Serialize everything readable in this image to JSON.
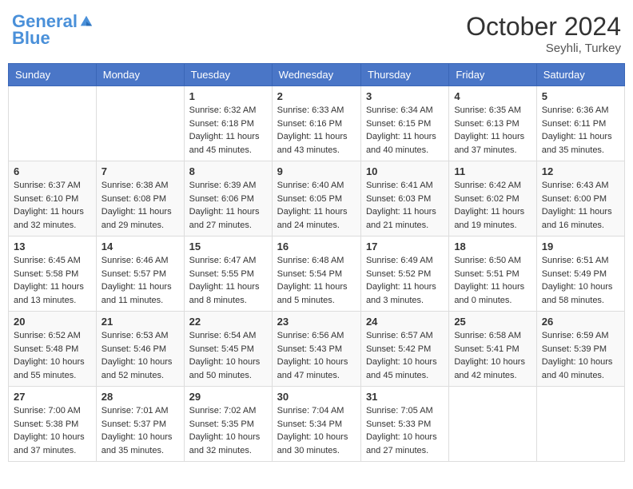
{
  "header": {
    "logo_line1": "General",
    "logo_line2": "Blue",
    "month_year": "October 2024",
    "location": "Seyhli, Turkey"
  },
  "weekdays": [
    "Sunday",
    "Monday",
    "Tuesday",
    "Wednesday",
    "Thursday",
    "Friday",
    "Saturday"
  ],
  "weeks": [
    [
      {
        "day": "",
        "sunrise": "",
        "sunset": "",
        "daylight": ""
      },
      {
        "day": "",
        "sunrise": "",
        "sunset": "",
        "daylight": ""
      },
      {
        "day": "1",
        "sunrise": "Sunrise: 6:32 AM",
        "sunset": "Sunset: 6:18 PM",
        "daylight": "Daylight: 11 hours and 45 minutes."
      },
      {
        "day": "2",
        "sunrise": "Sunrise: 6:33 AM",
        "sunset": "Sunset: 6:16 PM",
        "daylight": "Daylight: 11 hours and 43 minutes."
      },
      {
        "day": "3",
        "sunrise": "Sunrise: 6:34 AM",
        "sunset": "Sunset: 6:15 PM",
        "daylight": "Daylight: 11 hours and 40 minutes."
      },
      {
        "day": "4",
        "sunrise": "Sunrise: 6:35 AM",
        "sunset": "Sunset: 6:13 PM",
        "daylight": "Daylight: 11 hours and 37 minutes."
      },
      {
        "day": "5",
        "sunrise": "Sunrise: 6:36 AM",
        "sunset": "Sunset: 6:11 PM",
        "daylight": "Daylight: 11 hours and 35 minutes."
      }
    ],
    [
      {
        "day": "6",
        "sunrise": "Sunrise: 6:37 AM",
        "sunset": "Sunset: 6:10 PM",
        "daylight": "Daylight: 11 hours and 32 minutes."
      },
      {
        "day": "7",
        "sunrise": "Sunrise: 6:38 AM",
        "sunset": "Sunset: 6:08 PM",
        "daylight": "Daylight: 11 hours and 29 minutes."
      },
      {
        "day": "8",
        "sunrise": "Sunrise: 6:39 AM",
        "sunset": "Sunset: 6:06 PM",
        "daylight": "Daylight: 11 hours and 27 minutes."
      },
      {
        "day": "9",
        "sunrise": "Sunrise: 6:40 AM",
        "sunset": "Sunset: 6:05 PM",
        "daylight": "Daylight: 11 hours and 24 minutes."
      },
      {
        "day": "10",
        "sunrise": "Sunrise: 6:41 AM",
        "sunset": "Sunset: 6:03 PM",
        "daylight": "Daylight: 11 hours and 21 minutes."
      },
      {
        "day": "11",
        "sunrise": "Sunrise: 6:42 AM",
        "sunset": "Sunset: 6:02 PM",
        "daylight": "Daylight: 11 hours and 19 minutes."
      },
      {
        "day": "12",
        "sunrise": "Sunrise: 6:43 AM",
        "sunset": "Sunset: 6:00 PM",
        "daylight": "Daylight: 11 hours and 16 minutes."
      }
    ],
    [
      {
        "day": "13",
        "sunrise": "Sunrise: 6:45 AM",
        "sunset": "Sunset: 5:58 PM",
        "daylight": "Daylight: 11 hours and 13 minutes."
      },
      {
        "day": "14",
        "sunrise": "Sunrise: 6:46 AM",
        "sunset": "Sunset: 5:57 PM",
        "daylight": "Daylight: 11 hours and 11 minutes."
      },
      {
        "day": "15",
        "sunrise": "Sunrise: 6:47 AM",
        "sunset": "Sunset: 5:55 PM",
        "daylight": "Daylight: 11 hours and 8 minutes."
      },
      {
        "day": "16",
        "sunrise": "Sunrise: 6:48 AM",
        "sunset": "Sunset: 5:54 PM",
        "daylight": "Daylight: 11 hours and 5 minutes."
      },
      {
        "day": "17",
        "sunrise": "Sunrise: 6:49 AM",
        "sunset": "Sunset: 5:52 PM",
        "daylight": "Daylight: 11 hours and 3 minutes."
      },
      {
        "day": "18",
        "sunrise": "Sunrise: 6:50 AM",
        "sunset": "Sunset: 5:51 PM",
        "daylight": "Daylight: 11 hours and 0 minutes."
      },
      {
        "day": "19",
        "sunrise": "Sunrise: 6:51 AM",
        "sunset": "Sunset: 5:49 PM",
        "daylight": "Daylight: 10 hours and 58 minutes."
      }
    ],
    [
      {
        "day": "20",
        "sunrise": "Sunrise: 6:52 AM",
        "sunset": "Sunset: 5:48 PM",
        "daylight": "Daylight: 10 hours and 55 minutes."
      },
      {
        "day": "21",
        "sunrise": "Sunrise: 6:53 AM",
        "sunset": "Sunset: 5:46 PM",
        "daylight": "Daylight: 10 hours and 52 minutes."
      },
      {
        "day": "22",
        "sunrise": "Sunrise: 6:54 AM",
        "sunset": "Sunset: 5:45 PM",
        "daylight": "Daylight: 10 hours and 50 minutes."
      },
      {
        "day": "23",
        "sunrise": "Sunrise: 6:56 AM",
        "sunset": "Sunset: 5:43 PM",
        "daylight": "Daylight: 10 hours and 47 minutes."
      },
      {
        "day": "24",
        "sunrise": "Sunrise: 6:57 AM",
        "sunset": "Sunset: 5:42 PM",
        "daylight": "Daylight: 10 hours and 45 minutes."
      },
      {
        "day": "25",
        "sunrise": "Sunrise: 6:58 AM",
        "sunset": "Sunset: 5:41 PM",
        "daylight": "Daylight: 10 hours and 42 minutes."
      },
      {
        "day": "26",
        "sunrise": "Sunrise: 6:59 AM",
        "sunset": "Sunset: 5:39 PM",
        "daylight": "Daylight: 10 hours and 40 minutes."
      }
    ],
    [
      {
        "day": "27",
        "sunrise": "Sunrise: 7:00 AM",
        "sunset": "Sunset: 5:38 PM",
        "daylight": "Daylight: 10 hours and 37 minutes."
      },
      {
        "day": "28",
        "sunrise": "Sunrise: 7:01 AM",
        "sunset": "Sunset: 5:37 PM",
        "daylight": "Daylight: 10 hours and 35 minutes."
      },
      {
        "day": "29",
        "sunrise": "Sunrise: 7:02 AM",
        "sunset": "Sunset: 5:35 PM",
        "daylight": "Daylight: 10 hours and 32 minutes."
      },
      {
        "day": "30",
        "sunrise": "Sunrise: 7:04 AM",
        "sunset": "Sunset: 5:34 PM",
        "daylight": "Daylight: 10 hours and 30 minutes."
      },
      {
        "day": "31",
        "sunrise": "Sunrise: 7:05 AM",
        "sunset": "Sunset: 5:33 PM",
        "daylight": "Daylight: 10 hours and 27 minutes."
      },
      {
        "day": "",
        "sunrise": "",
        "sunset": "",
        "daylight": ""
      },
      {
        "day": "",
        "sunrise": "",
        "sunset": "",
        "daylight": ""
      }
    ]
  ]
}
